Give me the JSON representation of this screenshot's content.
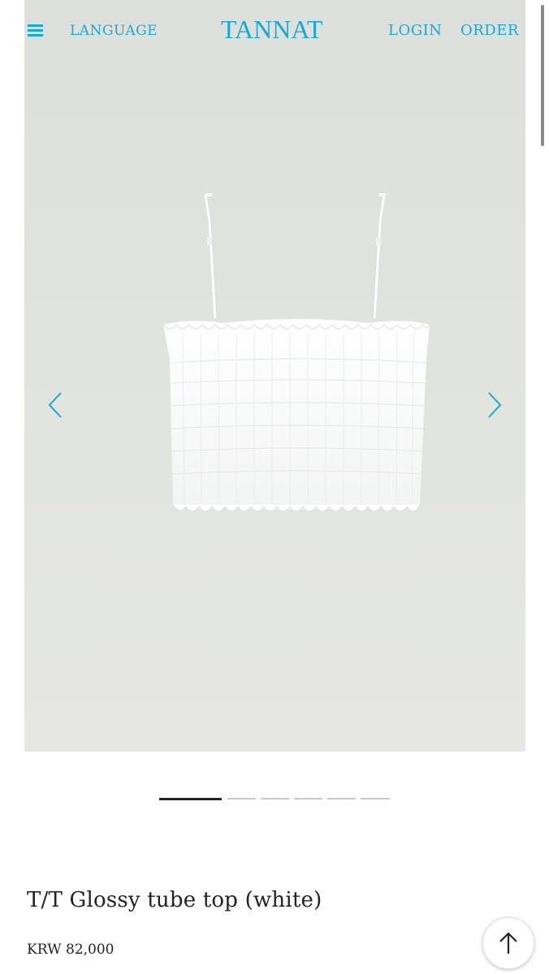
{
  "header": {
    "menu_icon": "hamburger-menu-icon",
    "language_label": "LANGUAGE",
    "brand": "TANNAT",
    "login_label": "LOGIN",
    "order_label": "ORDER"
  },
  "colors": {
    "accent": "#18a9d8",
    "text": "#222222",
    "image_background": "#e0e2dd"
  },
  "carousel": {
    "prev_icon": "chevron-left-icon",
    "next_icon": "chevron-right-icon",
    "total_slides": 6,
    "current_slide": 1
  },
  "product": {
    "title": "T/T Glossy tube top (white)",
    "price": "KRW 82,000"
  },
  "scroll_top_icon": "arrow-up-icon"
}
